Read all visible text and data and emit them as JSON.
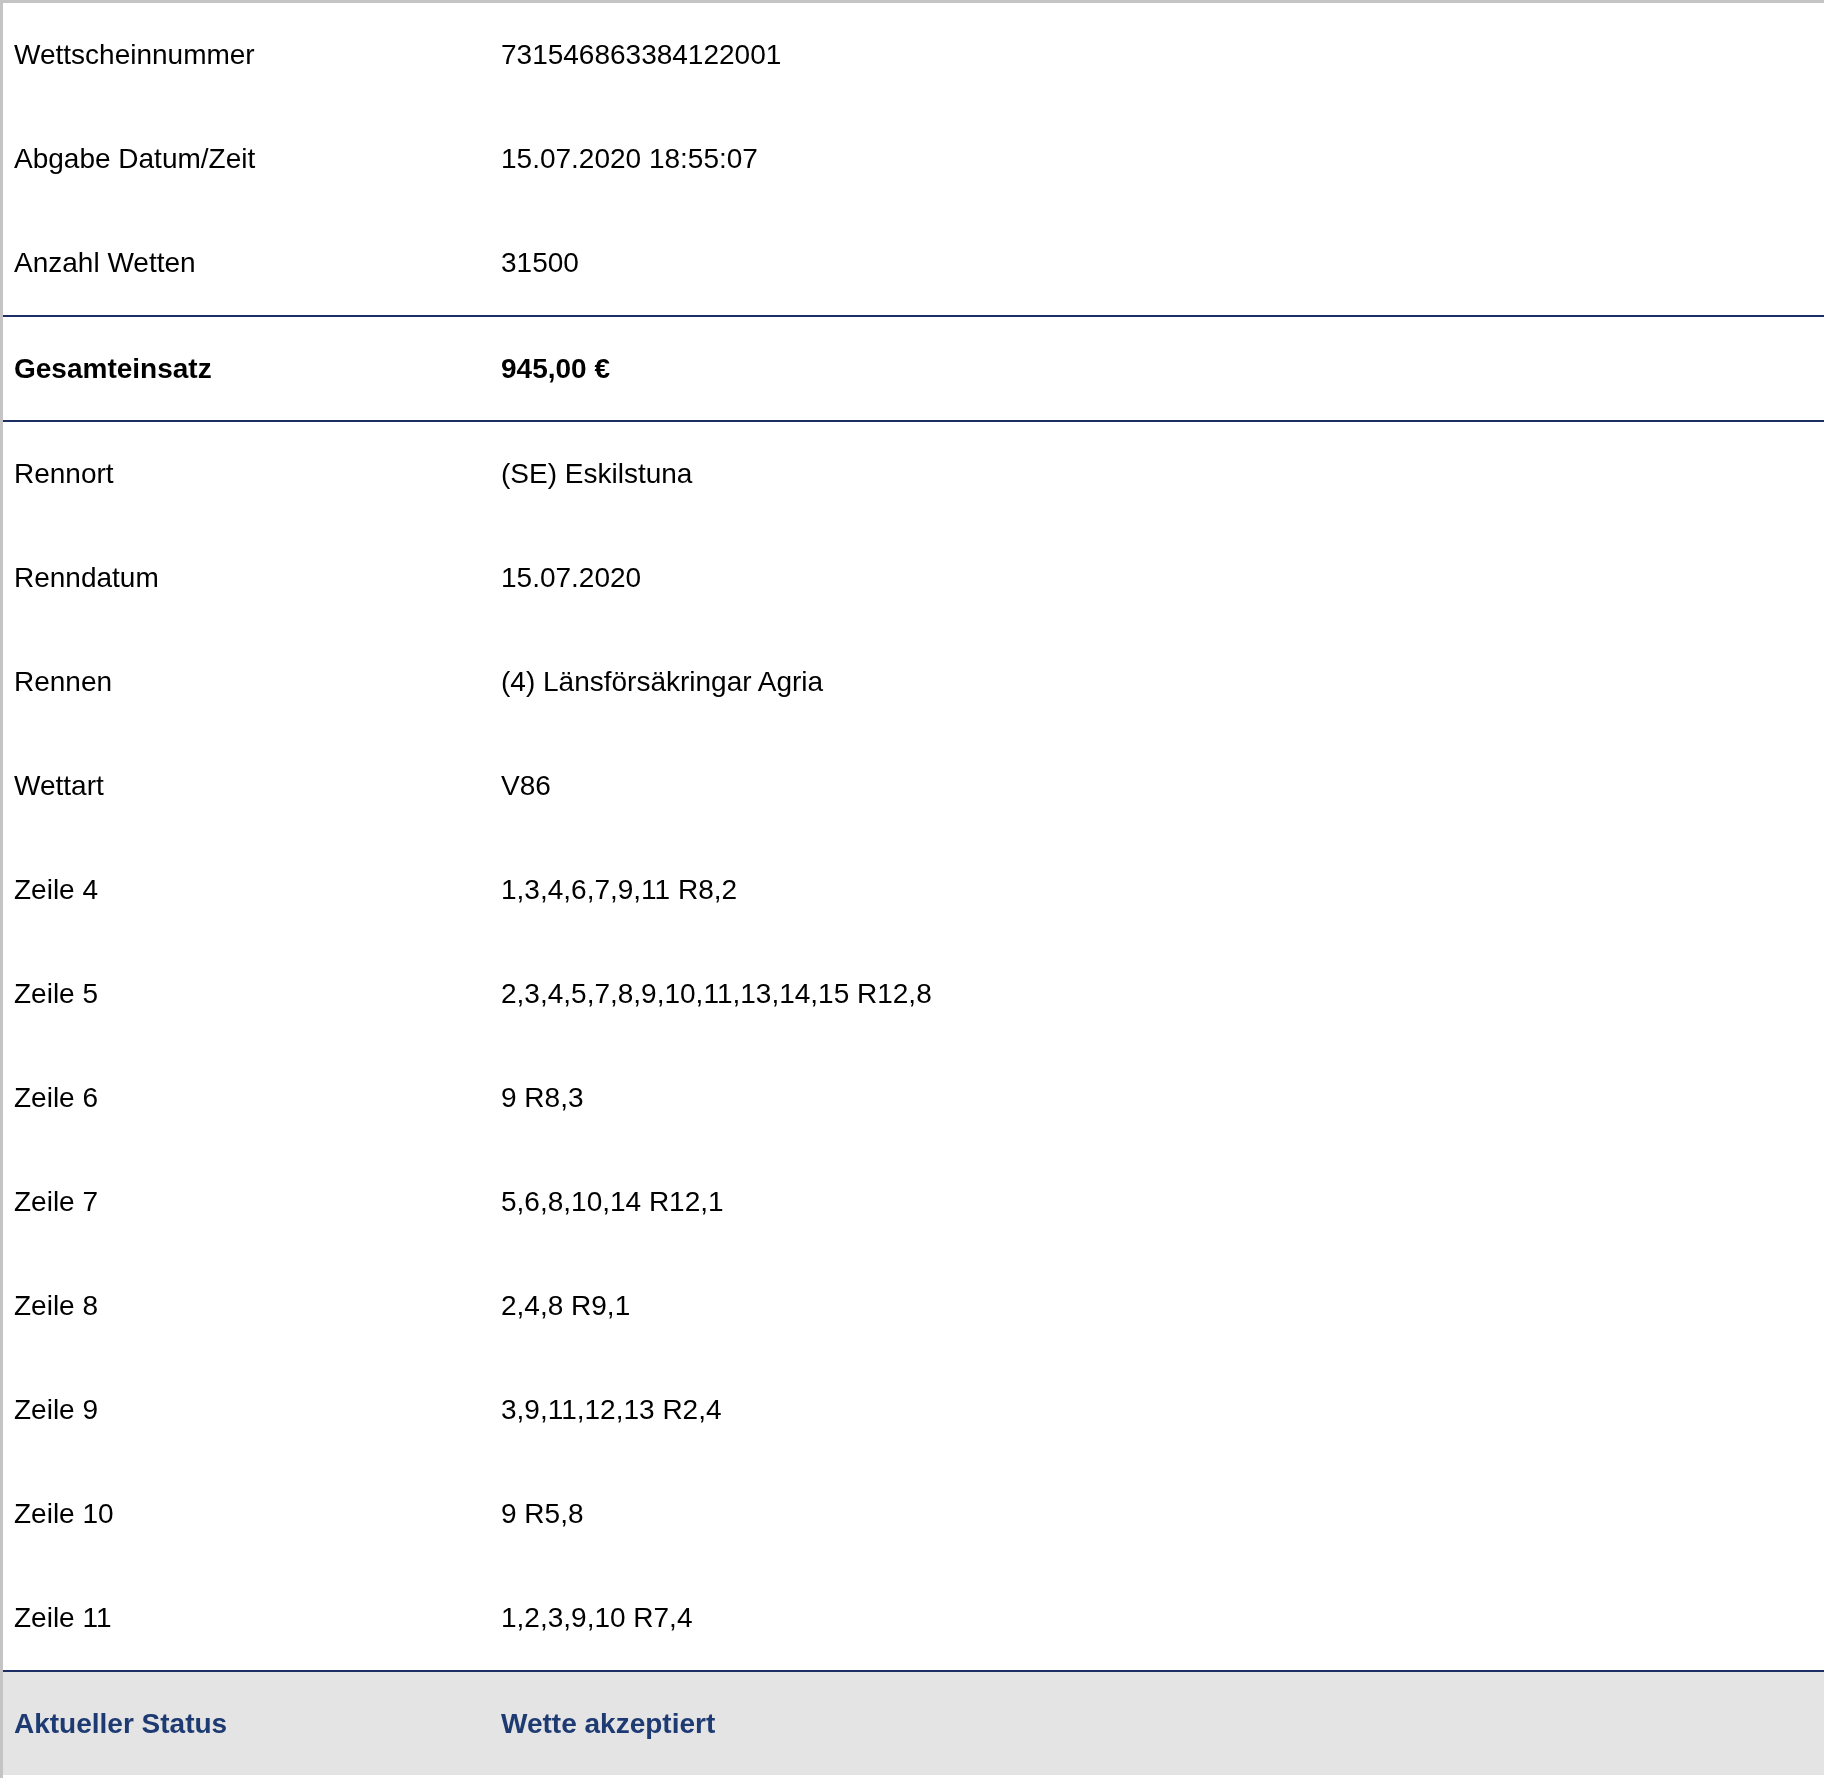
{
  "rows": [
    {
      "kind": "plain",
      "label": "Wettscheinnummer",
      "value": "731546863384122001"
    },
    {
      "kind": "plain",
      "label": "Abgabe Datum/Zeit",
      "value": "15.07.2020 18:55:07"
    },
    {
      "kind": "plain",
      "label": "Anzahl Wetten",
      "value": "31500"
    },
    {
      "kind": "total",
      "label": "Gesamteinsatz",
      "value": "945,00 €"
    },
    {
      "kind": "plain",
      "label": "Rennort",
      "value": "(SE) Eskilstuna"
    },
    {
      "kind": "plain",
      "label": "Renndatum",
      "value": "15.07.2020"
    },
    {
      "kind": "plain",
      "label": "Rennen",
      "value": "(4) Länsförsäkringar Agria"
    },
    {
      "kind": "plain",
      "label": "Wettart",
      "value": "V86"
    },
    {
      "kind": "plain",
      "label": "Zeile 4",
      "value": "1,3,4,6,7,9,11 R8,2"
    },
    {
      "kind": "plain",
      "label": "Zeile 5",
      "value": "2,3,4,5,7,8,9,10,11,13,14,15 R12,8"
    },
    {
      "kind": "plain",
      "label": "Zeile 6",
      "value": "9 R8,3"
    },
    {
      "kind": "plain",
      "label": "Zeile 7",
      "value": "5,6,8,10,14 R12,1"
    },
    {
      "kind": "plain",
      "label": "Zeile 8",
      "value": "2,4,8 R9,1"
    },
    {
      "kind": "plain",
      "label": "Zeile 9",
      "value": "3,9,11,12,13 R2,4"
    },
    {
      "kind": "plain",
      "label": "Zeile 10",
      "value": "9 R5,8"
    },
    {
      "kind": "plain",
      "label": "Zeile 11",
      "value": "1,2,3,9,10 R7,4"
    },
    {
      "kind": "status",
      "label": "Aktueller Status",
      "value": "Wette akzeptiert"
    }
  ]
}
